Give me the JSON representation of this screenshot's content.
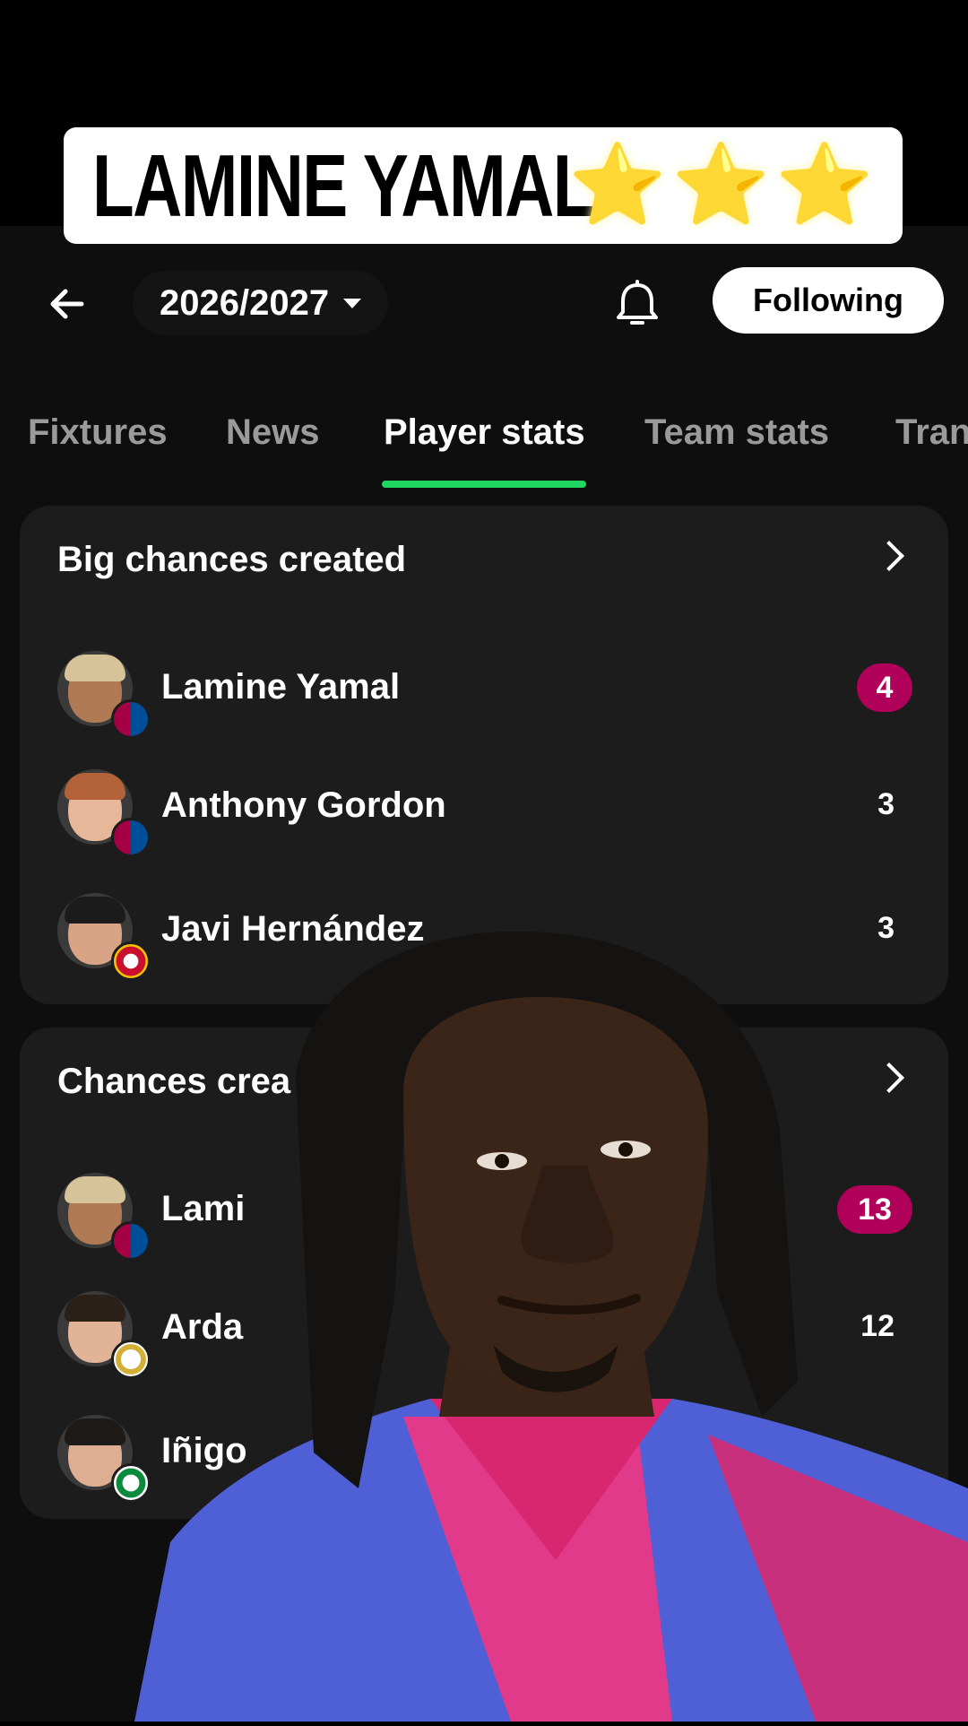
{
  "caption": {
    "title": "LAMINE YAMAL",
    "stars": [
      "⭐",
      "⭐",
      "⭐"
    ]
  },
  "header": {
    "season": "2026/2027",
    "follow_label": "Following"
  },
  "tabs": [
    "Fixtures",
    "News",
    "Player stats",
    "Team stats",
    "Tran"
  ],
  "active_tab": "Player stats",
  "cards": [
    {
      "title": "Big chances created",
      "rows": [
        {
          "name": "Lamine Yamal",
          "value": "4",
          "highlight": true,
          "club": "barcelona"
        },
        {
          "name": "Anthony Gordon",
          "value": "3",
          "highlight": false,
          "club": "barcelona"
        },
        {
          "name": "Javi Hernández",
          "value": "3",
          "highlight": false,
          "club": "espanyol"
        }
      ]
    },
    {
      "title": "Chances crea",
      "rows": [
        {
          "name": "Lami",
          "value": "13",
          "highlight": true,
          "club": "barcelona"
        },
        {
          "name": "Arda",
          "value": "12",
          "highlight": false,
          "club": "real-madrid"
        },
        {
          "name": "Iñigo",
          "value": "",
          "highlight": false,
          "club": "racing"
        }
      ]
    }
  ],
  "colors": {
    "accent_green": "#1fd760",
    "highlight_pill": "#b0005a",
    "card_bg": "#1c1c1c"
  }
}
